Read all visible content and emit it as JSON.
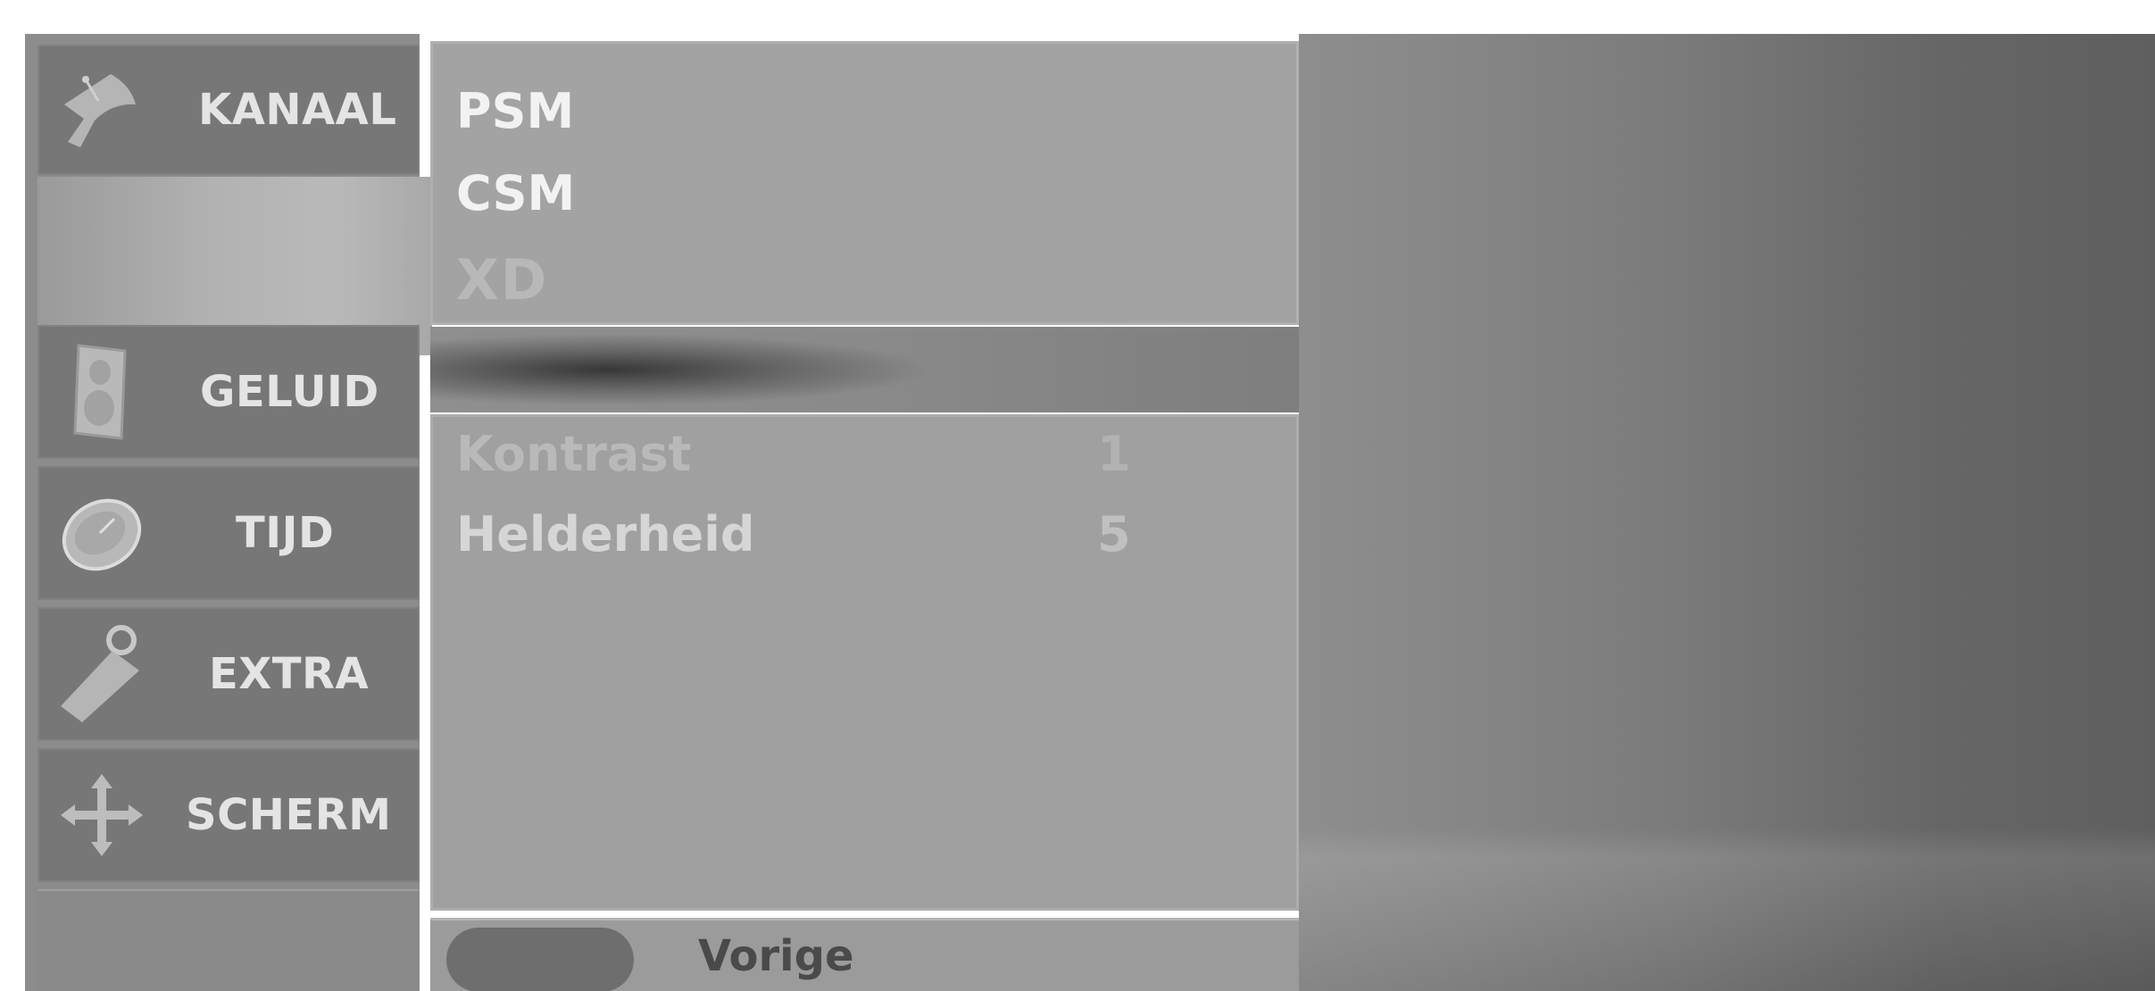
{
  "colors": {
    "accent": "#777777",
    "panel": "#a3a3a3",
    "text_light": "#f2f2f2"
  },
  "sidebar": {
    "items": [
      {
        "label": "KANAAL",
        "icon": "satellite-dish-icon"
      },
      {
        "label": "GELUID",
        "icon": "speaker-icon"
      },
      {
        "label": "TIJD",
        "icon": "clock-icon"
      },
      {
        "label": "EXTRA",
        "icon": "tag-icon"
      },
      {
        "label": "SCHERM",
        "icon": "move-arrows-icon"
      }
    ]
  },
  "menu": {
    "items": [
      {
        "label": "PSM"
      },
      {
        "label": "CSM"
      },
      {
        "label": "XD"
      }
    ]
  },
  "settings": [
    {
      "label": "Kontrast",
      "value": "1"
    },
    {
      "label": "Helderheid",
      "value": "5"
    }
  ],
  "footer": {
    "prev_label": "Vorige"
  }
}
